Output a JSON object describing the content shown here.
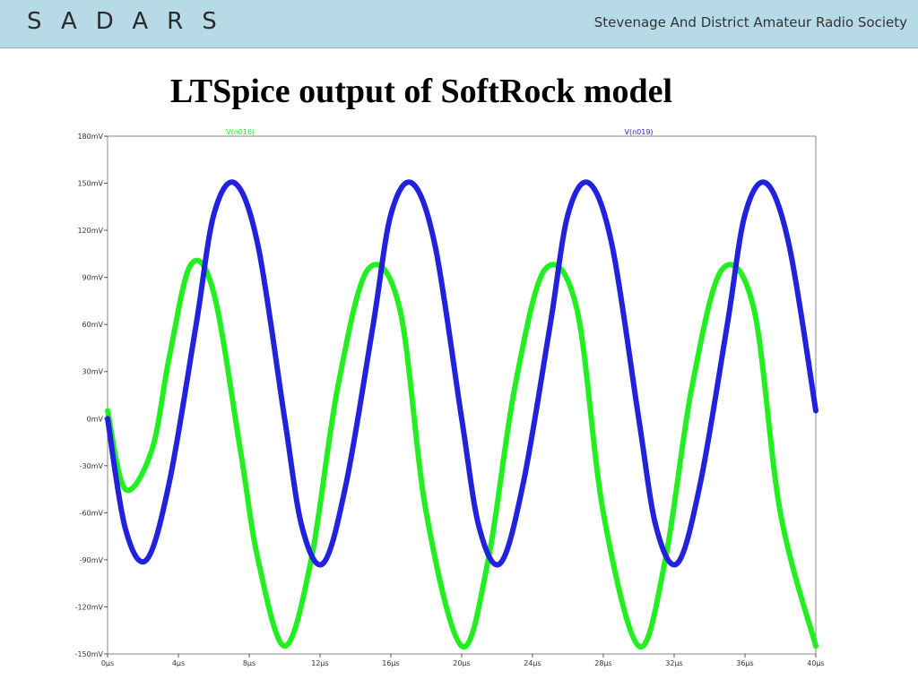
{
  "header": {
    "logo_text": "SADARS",
    "society_name": "Stevenage And District Amateur Radio Society",
    "background_color": "#b6dbe6"
  },
  "slide": {
    "title": "LTSpice output of SoftRock model"
  },
  "chart_data": {
    "type": "line",
    "title": "",
    "xlabel": "",
    "ylabel": "",
    "xlim": [
      0,
      40
    ],
    "ylim": [
      -150,
      180
    ],
    "x_unit": "μs",
    "y_unit": "mV",
    "grid": false,
    "x_ticks": [
      "0μs",
      "4μs",
      "8μs",
      "12μs",
      "16μs",
      "20μs",
      "24μs",
      "28μs",
      "32μs",
      "36μs",
      "40μs"
    ],
    "y_ticks": [
      "180mV",
      "150mV",
      "120mV",
      "90mV",
      "60mV",
      "30mV",
      "0mV",
      "-30mV",
      "-60mV",
      "-90mV",
      "-120mV",
      "-150mV"
    ],
    "series": [
      {
        "name": "V(n016)",
        "color": "#22ee22",
        "x": [
          0,
          1,
          2.5,
          3.5,
          4.7,
          6,
          7.5,
          8.5,
          10,
          11.5,
          13,
          14.7,
          16.5,
          18,
          20,
          21.5,
          23,
          24.7,
          26.5,
          28,
          30,
          31.5,
          33,
          34.7,
          36.5,
          38,
          40
        ],
        "y": [
          5,
          -45,
          -20,
          40,
          98,
          80,
          -20,
          -90,
          -145,
          -90,
          20,
          95,
          70,
          -60,
          -145,
          -90,
          20,
          95,
          70,
          -60,
          -145,
          -90,
          20,
          95,
          70,
          -60,
          -145
        ]
      },
      {
        "name": "V(n019)",
        "color": "#2222dd",
        "x": [
          0,
          1,
          2.2,
          3.5,
          5,
          6,
          7.2,
          8.5,
          10,
          11,
          12.2,
          13.5,
          15,
          16,
          17.2,
          18.5,
          20,
          21,
          22.2,
          23.5,
          25,
          26,
          27.2,
          28.5,
          30,
          31,
          32.2,
          33.5,
          35,
          36,
          37.2,
          38.5,
          40
        ],
        "y": [
          0,
          -70,
          -90,
          -40,
          60,
          130,
          150,
          110,
          0,
          -70,
          -92,
          -40,
          60,
          130,
          150,
          110,
          0,
          -70,
          -92,
          -40,
          60,
          130,
          150,
          110,
          0,
          -70,
          -92,
          -40,
          60,
          130,
          150,
          110,
          5
        ]
      }
    ]
  }
}
